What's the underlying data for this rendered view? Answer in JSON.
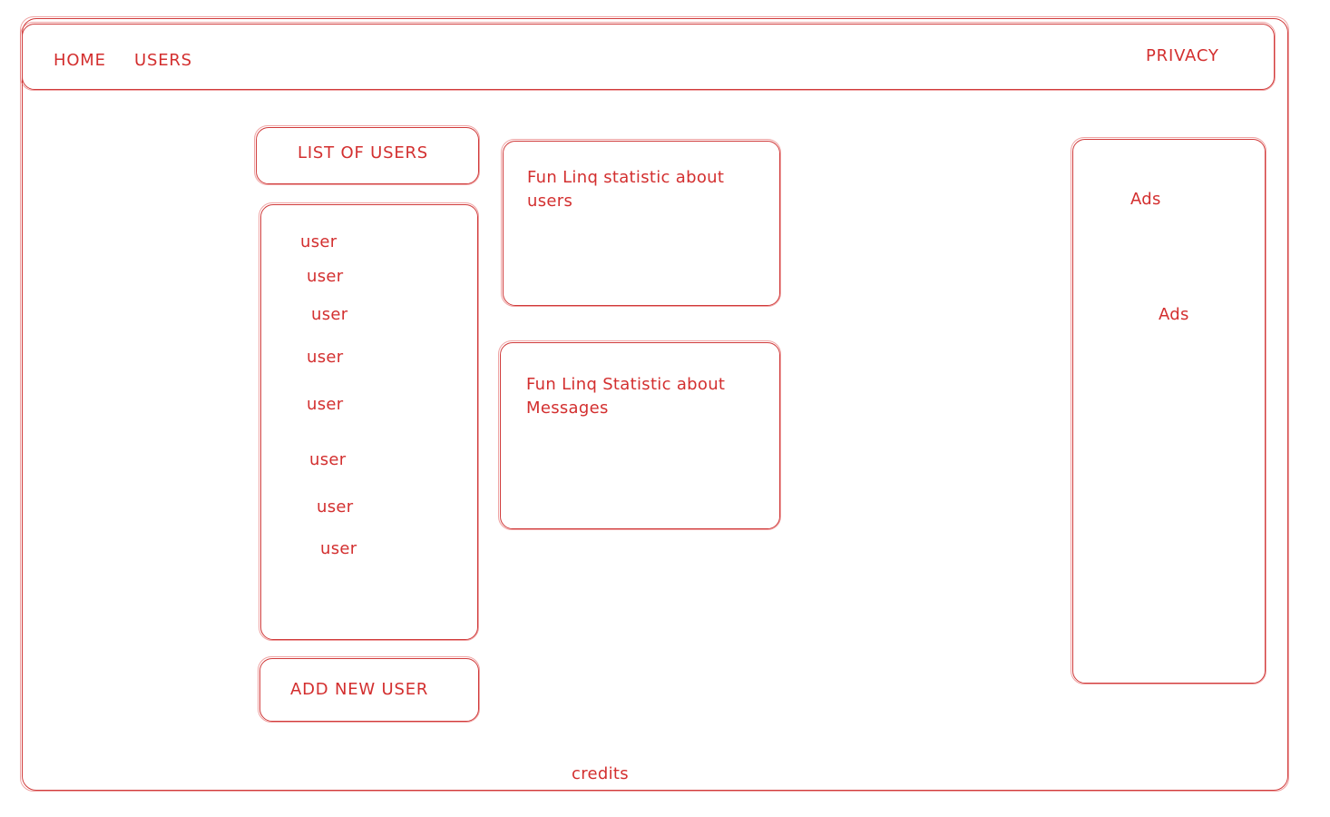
{
  "nav": {
    "home": "HOME",
    "users": "USERS",
    "privacy": "PRIVACY"
  },
  "list_header": "LIST OF USERS",
  "users": [
    "user",
    "user",
    "user",
    "user",
    "user",
    "user",
    "user",
    "user"
  ],
  "add_button": "ADD NEW USER",
  "stats": {
    "users_title": "Fun Linq statistic about users",
    "messages_title": "Fun Linq Statistic about Messages"
  },
  "ads": [
    "Ads",
    "Ads"
  ],
  "footer": {
    "credits": "credits"
  },
  "colors": {
    "stroke": "#d03a3a",
    "text": "#d32f2f"
  }
}
